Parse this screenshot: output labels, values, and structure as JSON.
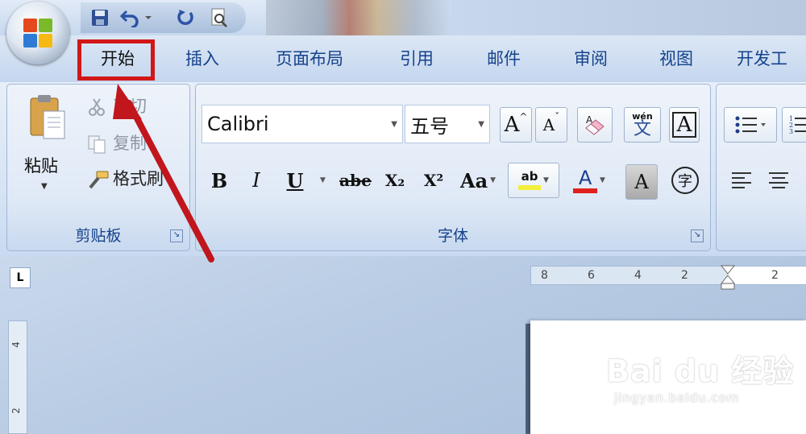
{
  "quick_access": {
    "icons": [
      "save-icon",
      "undo-icon",
      "dropdown-icon",
      "redo-icon",
      "print-preview-icon"
    ]
  },
  "tabs": [
    {
      "label": "开始",
      "active": true
    },
    {
      "label": "插入",
      "active": false
    },
    {
      "label": "页面布局",
      "active": false
    },
    {
      "label": "引用",
      "active": false
    },
    {
      "label": "邮件",
      "active": false
    },
    {
      "label": "审阅",
      "active": false
    },
    {
      "label": "视图",
      "active": false
    },
    {
      "label": "开发工",
      "active": false
    }
  ],
  "clipboard": {
    "paste_label": "粘贴",
    "cut_label": "剪切",
    "copy_label": "复制",
    "format_painter_label": "格式刷",
    "group_label": "剪贴板"
  },
  "font": {
    "font_name": "Calibri",
    "font_size": "五号",
    "grow_label": "A",
    "shrink_label": "A",
    "clear_format_label": "A",
    "bold": "B",
    "italic": "I",
    "underline": "U",
    "strike": "abe",
    "subscript": "X₂",
    "superscript": "X²",
    "change_case": "Aa",
    "highlight": "ab",
    "font_color": "A",
    "char_shading": "A",
    "enclose_char": "字",
    "phonetic": "wén",
    "phonetic_char": "文",
    "group_label": "字体",
    "font_color_hex": "#e0201c",
    "highlight_hex": "#f4ef3a"
  },
  "ruler": {
    "corner": "L",
    "h_numbers": [
      "8",
      "6",
      "4",
      "2",
      "2"
    ],
    "v_numbers": [
      "4",
      "2"
    ]
  },
  "watermark": {
    "main": "Bai du 经验",
    "sub": "jingyan.baidu.com"
  },
  "colors": {
    "highlight_box": "#d11717",
    "tab_text": "#15428b"
  }
}
